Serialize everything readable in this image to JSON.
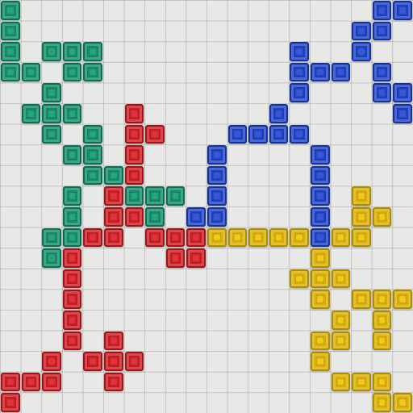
{
  "game": "Blokus",
  "board": {
    "grid_size": 20,
    "background": "#e8e8e6",
    "grid_line_color": "#a6a6a6"
  },
  "colors": {
    "green": "#0f9a72",
    "red": "#e01b22",
    "blue": "#1d46d8",
    "yellow": "#f2c200"
  },
  "tiles": [
    {
      "color": "green",
      "col": 0,
      "row": 0
    },
    {
      "color": "green",
      "col": 0,
      "row": 1
    },
    {
      "color": "green",
      "col": 0,
      "row": 2
    },
    {
      "color": "green",
      "col": 0,
      "row": 3
    },
    {
      "color": "green",
      "col": 1,
      "row": 3
    },
    {
      "color": "green",
      "col": 2,
      "row": 2
    },
    {
      "color": "green",
      "col": 3,
      "row": 2
    },
    {
      "color": "green",
      "col": 4,
      "row": 2
    },
    {
      "color": "green",
      "col": 3,
      "row": 3
    },
    {
      "color": "green",
      "col": 4,
      "row": 3
    },
    {
      "color": "green",
      "col": 2,
      "row": 4
    },
    {
      "color": "green",
      "col": 1,
      "row": 5
    },
    {
      "color": "green",
      "col": 2,
      "row": 5
    },
    {
      "color": "green",
      "col": 3,
      "row": 5
    },
    {
      "color": "green",
      "col": 2,
      "row": 6
    },
    {
      "color": "green",
      "col": 4,
      "row": 6
    },
    {
      "color": "green",
      "col": 3,
      "row": 7
    },
    {
      "color": "green",
      "col": 4,
      "row": 7
    },
    {
      "color": "green",
      "col": 4,
      "row": 8
    },
    {
      "color": "green",
      "col": 5,
      "row": 8
    },
    {
      "color": "green",
      "col": 3,
      "row": 9
    },
    {
      "color": "green",
      "col": 3,
      "row": 10
    },
    {
      "color": "green",
      "col": 3,
      "row": 11
    },
    {
      "color": "green",
      "col": 2,
      "row": 11
    },
    {
      "color": "green",
      "col": 2,
      "row": 12
    },
    {
      "color": "green",
      "col": 6,
      "row": 9
    },
    {
      "color": "green",
      "col": 7,
      "row": 9
    },
    {
      "color": "green",
      "col": 8,
      "row": 9
    },
    {
      "color": "green",
      "col": 7,
      "row": 10
    },
    {
      "color": "red",
      "col": 6,
      "row": 5
    },
    {
      "color": "red",
      "col": 6,
      "row": 6
    },
    {
      "color": "red",
      "col": 7,
      "row": 6
    },
    {
      "color": "red",
      "col": 6,
      "row": 7
    },
    {
      "color": "red",
      "col": 6,
      "row": 8
    },
    {
      "color": "red",
      "col": 5,
      "row": 9
    },
    {
      "color": "red",
      "col": 5,
      "row": 10
    },
    {
      "color": "red",
      "col": 6,
      "row": 10
    },
    {
      "color": "red",
      "col": 4,
      "row": 11
    },
    {
      "color": "red",
      "col": 5,
      "row": 11
    },
    {
      "color": "red",
      "col": 7,
      "row": 11
    },
    {
      "color": "red",
      "col": 8,
      "row": 11
    },
    {
      "color": "red",
      "col": 9,
      "row": 11
    },
    {
      "color": "red",
      "col": 8,
      "row": 12
    },
    {
      "color": "red",
      "col": 9,
      "row": 12
    },
    {
      "color": "red",
      "col": 3,
      "row": 12
    },
    {
      "color": "red",
      "col": 3,
      "row": 13
    },
    {
      "color": "red",
      "col": 3,
      "row": 14
    },
    {
      "color": "red",
      "col": 3,
      "row": 15
    },
    {
      "color": "red",
      "col": 3,
      "row": 16
    },
    {
      "color": "red",
      "col": 2,
      "row": 17
    },
    {
      "color": "red",
      "col": 2,
      "row": 18
    },
    {
      "color": "red",
      "col": 1,
      "row": 18
    },
    {
      "color": "red",
      "col": 0,
      "row": 18
    },
    {
      "color": "red",
      "col": 0,
      "row": 19
    },
    {
      "color": "red",
      "col": 5,
      "row": 16
    },
    {
      "color": "red",
      "col": 4,
      "row": 17
    },
    {
      "color": "red",
      "col": 5,
      "row": 17
    },
    {
      "color": "red",
      "col": 6,
      "row": 17
    },
    {
      "color": "red",
      "col": 5,
      "row": 18
    },
    {
      "color": "blue",
      "col": 18,
      "row": 0
    },
    {
      "color": "blue",
      "col": 19,
      "row": 0
    },
    {
      "color": "blue",
      "col": 17,
      "row": 1
    },
    {
      "color": "blue",
      "col": 18,
      "row": 1
    },
    {
      "color": "blue",
      "col": 17,
      "row": 2
    },
    {
      "color": "blue",
      "col": 14,
      "row": 2
    },
    {
      "color": "blue",
      "col": 14,
      "row": 3
    },
    {
      "color": "blue",
      "col": 15,
      "row": 3
    },
    {
      "color": "blue",
      "col": 16,
      "row": 3
    },
    {
      "color": "blue",
      "col": 14,
      "row": 4
    },
    {
      "color": "blue",
      "col": 18,
      "row": 3
    },
    {
      "color": "blue",
      "col": 18,
      "row": 4
    },
    {
      "color": "blue",
      "col": 19,
      "row": 4
    },
    {
      "color": "blue",
      "col": 19,
      "row": 5
    },
    {
      "color": "blue",
      "col": 13,
      "row": 5
    },
    {
      "color": "blue",
      "col": 11,
      "row": 6
    },
    {
      "color": "blue",
      "col": 12,
      "row": 6
    },
    {
      "color": "blue",
      "col": 13,
      "row": 6
    },
    {
      "color": "blue",
      "col": 14,
      "row": 6
    },
    {
      "color": "blue",
      "col": 10,
      "row": 7
    },
    {
      "color": "blue",
      "col": 10,
      "row": 8
    },
    {
      "color": "blue",
      "col": 10,
      "row": 9
    },
    {
      "color": "blue",
      "col": 9,
      "row": 10
    },
    {
      "color": "blue",
      "col": 10,
      "row": 10
    },
    {
      "color": "blue",
      "col": 15,
      "row": 7
    },
    {
      "color": "blue",
      "col": 15,
      "row": 8
    },
    {
      "color": "blue",
      "col": 15,
      "row": 9
    },
    {
      "color": "blue",
      "col": 15,
      "row": 10
    },
    {
      "color": "blue",
      "col": 15,
      "row": 11
    },
    {
      "color": "yellow",
      "col": 10,
      "row": 11
    },
    {
      "color": "yellow",
      "col": 11,
      "row": 11
    },
    {
      "color": "yellow",
      "col": 12,
      "row": 11
    },
    {
      "color": "yellow",
      "col": 13,
      "row": 11
    },
    {
      "color": "yellow",
      "col": 14,
      "row": 11
    },
    {
      "color": "yellow",
      "col": 16,
      "row": 11
    },
    {
      "color": "yellow",
      "col": 17,
      "row": 11
    },
    {
      "color": "yellow",
      "col": 17,
      "row": 9
    },
    {
      "color": "yellow",
      "col": 17,
      "row": 10
    },
    {
      "color": "yellow",
      "col": 18,
      "row": 10
    },
    {
      "color": "yellow",
      "col": 15,
      "row": 12
    },
    {
      "color": "yellow",
      "col": 14,
      "row": 13
    },
    {
      "color": "yellow",
      "col": 15,
      "row": 13
    },
    {
      "color": "yellow",
      "col": 16,
      "row": 13
    },
    {
      "color": "yellow",
      "col": 15,
      "row": 14
    },
    {
      "color": "yellow",
      "col": 17,
      "row": 14
    },
    {
      "color": "yellow",
      "col": 18,
      "row": 14
    },
    {
      "color": "yellow",
      "col": 19,
      "row": 14
    },
    {
      "color": "yellow",
      "col": 16,
      "row": 15
    },
    {
      "color": "yellow",
      "col": 18,
      "row": 15
    },
    {
      "color": "yellow",
      "col": 15,
      "row": 16
    },
    {
      "color": "yellow",
      "col": 16,
      "row": 16
    },
    {
      "color": "yellow",
      "col": 18,
      "row": 16
    },
    {
      "color": "yellow",
      "col": 15,
      "row": 17
    },
    {
      "color": "yellow",
      "col": 16,
      "row": 18
    },
    {
      "color": "yellow",
      "col": 17,
      "row": 18
    },
    {
      "color": "yellow",
      "col": 18,
      "row": 18
    },
    {
      "color": "yellow",
      "col": 18,
      "row": 19
    },
    {
      "color": "yellow",
      "col": 19,
      "row": 19
    }
  ]
}
